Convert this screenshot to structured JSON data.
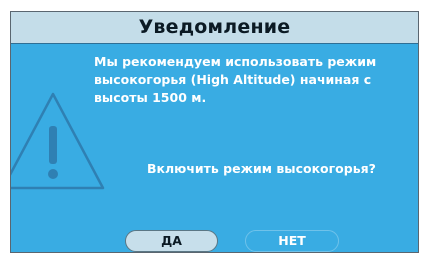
{
  "dialog": {
    "title": "Уведомление",
    "message": "Мы рекомендуем использовать режим\nвысокогорья (High Altitude) начиная с\nвысоты 1500 м.",
    "question": "Включить режим высокогорья?",
    "icon": "warning-triangle-icon"
  },
  "buttons": {
    "yes_label": "ДА",
    "no_label": "НЕТ",
    "selected": "yes"
  },
  "colors": {
    "panel_background": "#39ace3",
    "title_background": "#c4dde9",
    "selected_button": "#c7dfeb",
    "text": "#ffffff"
  }
}
